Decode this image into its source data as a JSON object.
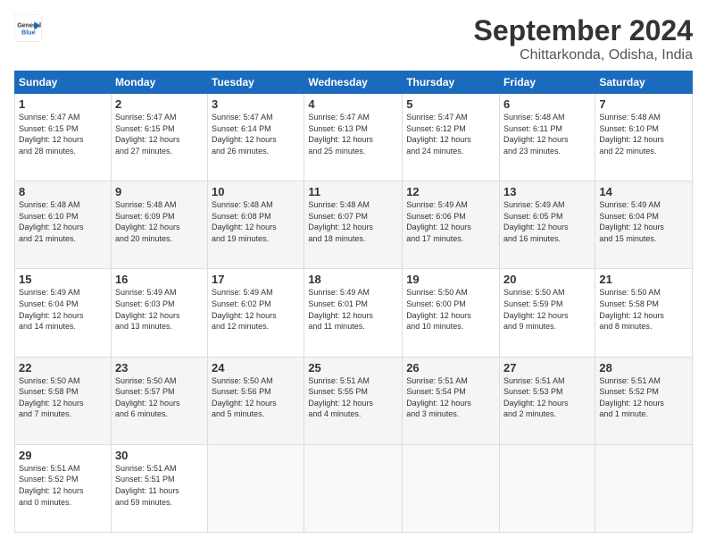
{
  "logo": {
    "general": "General",
    "blue": "Blue"
  },
  "header": {
    "month_title": "September 2024",
    "subtitle": "Chittarkonda, Odisha, India"
  },
  "weekdays": [
    "Sunday",
    "Monday",
    "Tuesday",
    "Wednesday",
    "Thursday",
    "Friday",
    "Saturday"
  ],
  "weeks": [
    [
      {
        "day": "1",
        "info": "Sunrise: 5:47 AM\nSunset: 6:15 PM\nDaylight: 12 hours\nand 28 minutes."
      },
      {
        "day": "2",
        "info": "Sunrise: 5:47 AM\nSunset: 6:15 PM\nDaylight: 12 hours\nand 27 minutes."
      },
      {
        "day": "3",
        "info": "Sunrise: 5:47 AM\nSunset: 6:14 PM\nDaylight: 12 hours\nand 26 minutes."
      },
      {
        "day": "4",
        "info": "Sunrise: 5:47 AM\nSunset: 6:13 PM\nDaylight: 12 hours\nand 25 minutes."
      },
      {
        "day": "5",
        "info": "Sunrise: 5:47 AM\nSunset: 6:12 PM\nDaylight: 12 hours\nand 24 minutes."
      },
      {
        "day": "6",
        "info": "Sunrise: 5:48 AM\nSunset: 6:11 PM\nDaylight: 12 hours\nand 23 minutes."
      },
      {
        "day": "7",
        "info": "Sunrise: 5:48 AM\nSunset: 6:10 PM\nDaylight: 12 hours\nand 22 minutes."
      }
    ],
    [
      {
        "day": "8",
        "info": "Sunrise: 5:48 AM\nSunset: 6:10 PM\nDaylight: 12 hours\nand 21 minutes."
      },
      {
        "day": "9",
        "info": "Sunrise: 5:48 AM\nSunset: 6:09 PM\nDaylight: 12 hours\nand 20 minutes."
      },
      {
        "day": "10",
        "info": "Sunrise: 5:48 AM\nSunset: 6:08 PM\nDaylight: 12 hours\nand 19 minutes."
      },
      {
        "day": "11",
        "info": "Sunrise: 5:48 AM\nSunset: 6:07 PM\nDaylight: 12 hours\nand 18 minutes."
      },
      {
        "day": "12",
        "info": "Sunrise: 5:49 AM\nSunset: 6:06 PM\nDaylight: 12 hours\nand 17 minutes."
      },
      {
        "day": "13",
        "info": "Sunrise: 5:49 AM\nSunset: 6:05 PM\nDaylight: 12 hours\nand 16 minutes."
      },
      {
        "day": "14",
        "info": "Sunrise: 5:49 AM\nSunset: 6:04 PM\nDaylight: 12 hours\nand 15 minutes."
      }
    ],
    [
      {
        "day": "15",
        "info": "Sunrise: 5:49 AM\nSunset: 6:04 PM\nDaylight: 12 hours\nand 14 minutes."
      },
      {
        "day": "16",
        "info": "Sunrise: 5:49 AM\nSunset: 6:03 PM\nDaylight: 12 hours\nand 13 minutes."
      },
      {
        "day": "17",
        "info": "Sunrise: 5:49 AM\nSunset: 6:02 PM\nDaylight: 12 hours\nand 12 minutes."
      },
      {
        "day": "18",
        "info": "Sunrise: 5:49 AM\nSunset: 6:01 PM\nDaylight: 12 hours\nand 11 minutes."
      },
      {
        "day": "19",
        "info": "Sunrise: 5:50 AM\nSunset: 6:00 PM\nDaylight: 12 hours\nand 10 minutes."
      },
      {
        "day": "20",
        "info": "Sunrise: 5:50 AM\nSunset: 5:59 PM\nDaylight: 12 hours\nand 9 minutes."
      },
      {
        "day": "21",
        "info": "Sunrise: 5:50 AM\nSunset: 5:58 PM\nDaylight: 12 hours\nand 8 minutes."
      }
    ],
    [
      {
        "day": "22",
        "info": "Sunrise: 5:50 AM\nSunset: 5:58 PM\nDaylight: 12 hours\nand 7 minutes."
      },
      {
        "day": "23",
        "info": "Sunrise: 5:50 AM\nSunset: 5:57 PM\nDaylight: 12 hours\nand 6 minutes."
      },
      {
        "day": "24",
        "info": "Sunrise: 5:50 AM\nSunset: 5:56 PM\nDaylight: 12 hours\nand 5 minutes."
      },
      {
        "day": "25",
        "info": "Sunrise: 5:51 AM\nSunset: 5:55 PM\nDaylight: 12 hours\nand 4 minutes."
      },
      {
        "day": "26",
        "info": "Sunrise: 5:51 AM\nSunset: 5:54 PM\nDaylight: 12 hours\nand 3 minutes."
      },
      {
        "day": "27",
        "info": "Sunrise: 5:51 AM\nSunset: 5:53 PM\nDaylight: 12 hours\nand 2 minutes."
      },
      {
        "day": "28",
        "info": "Sunrise: 5:51 AM\nSunset: 5:52 PM\nDaylight: 12 hours\nand 1 minute."
      }
    ],
    [
      {
        "day": "29",
        "info": "Sunrise: 5:51 AM\nSunset: 5:52 PM\nDaylight: 12 hours\nand 0 minutes."
      },
      {
        "day": "30",
        "info": "Sunrise: 5:51 AM\nSunset: 5:51 PM\nDaylight: 11 hours\nand 59 minutes."
      },
      {
        "day": "",
        "info": ""
      },
      {
        "day": "",
        "info": ""
      },
      {
        "day": "",
        "info": ""
      },
      {
        "day": "",
        "info": ""
      },
      {
        "day": "",
        "info": ""
      }
    ]
  ]
}
